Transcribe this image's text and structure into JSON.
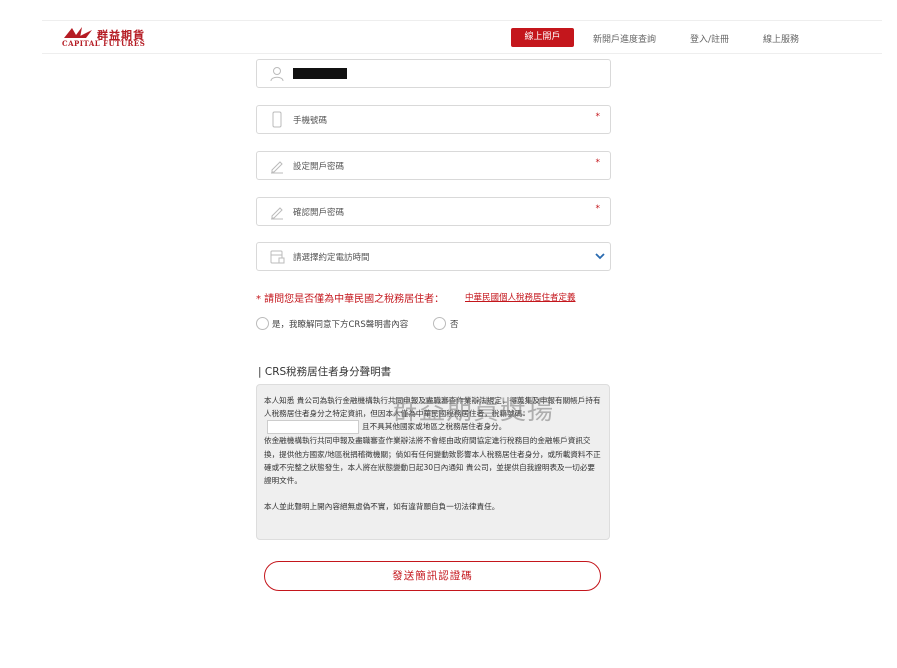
{
  "header": {
    "logo_cn": "群益期貨",
    "logo_en": "CAPITAL FUTURES",
    "nav": {
      "primary": "線上開戶",
      "progress": "新開戶進度查詢",
      "login": "登入/註冊",
      "service": "線上服務"
    }
  },
  "form": {
    "phone_placeholder": "手機號碼",
    "password_placeholder": "設定開戶密碼",
    "confirm_password_placeholder": "確認開戶密碼",
    "call_time_placeholder": "請選擇約定電訪時間",
    "required_mark": "*"
  },
  "tax": {
    "question": "* 請問您是否僅為中華民國之稅務居住者：",
    "definition_link": "中華民國個人稅務居住者定義",
    "option_yes": "是，我瞭解同意下方CRS聲明書內容",
    "option_no": "否"
  },
  "declaration": {
    "title": "| CRS稅務居住者身分聲明書",
    "para1_a": "本人知悉 貴公司為執行金融機構執行共同申報及盡職審查作業辦法規定，得蒐集及申報有關帳戶持有人稅務居住者身分之特定資訊，但因本人僅為中華民國稅務居住者，稅籍號碼：",
    "para1_b": "且不具其他國家或地區之稅務居住者身分。",
    "para2": "依金融機構執行共同申報及盡職審查作業辦法將不會經由政府間協定進行稅務目的金融帳戶資訊交換，提供他方國家/地區稅捐稽徵機關；倘如有任何變動致影響本人稅務居住者身分，或所載資料不正確或不完整之狀態發生，本人將在狀態變動日起30日內通知 貴公司，並提供自我證明表及一切必要證明文件。",
    "para3": "本人並此聲明上開內容絕無虛偽不實，如有違背願自負一切法律責任。"
  },
  "watermark": "群益期貨獎揚",
  "send_button": "發送簡訊認證碼",
  "colors": {
    "brand_red": "#c4161c",
    "border": "#d9d9d9",
    "declaration_bg": "#efefef"
  }
}
